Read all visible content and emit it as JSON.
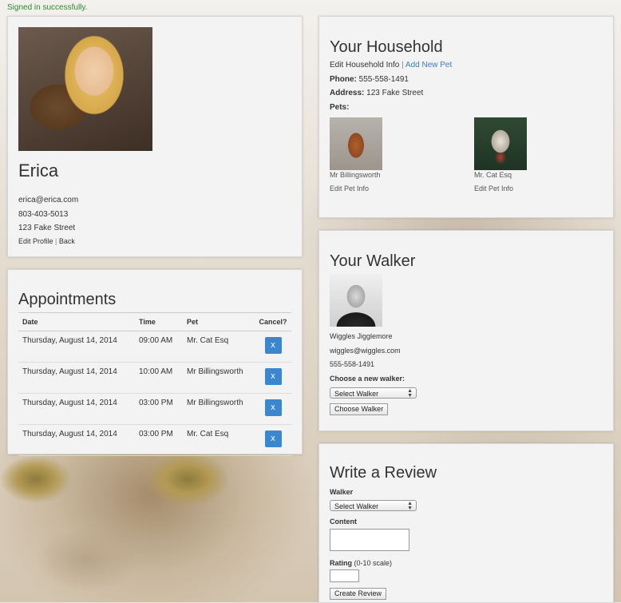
{
  "flash": "Signed in successfully.",
  "profile": {
    "name": "Erica",
    "email": "erica@erica.com",
    "phone": "803-403-5013",
    "address": "123 Fake Street",
    "edit_link": "Edit Profile",
    "separator": "|",
    "back_link": "Back"
  },
  "appointments": {
    "title": "Appointments",
    "headers": [
      "Date",
      "Time",
      "Pet",
      "Cancel?"
    ],
    "rows": [
      {
        "date": "Thursday, August 14, 2014",
        "time": "09:00 AM",
        "pet": "Mr. Cat Esq",
        "cancel": "x"
      },
      {
        "date": "Thursday, August 14, 2014",
        "time": "10:00 AM",
        "pet": "Mr Billingsworth",
        "cancel": "x"
      },
      {
        "date": "Thursday, August 14, 2014",
        "time": "03:00 PM",
        "pet": "Mr Billingsworth",
        "cancel": "x"
      },
      {
        "date": "Thursday, August 14, 2014",
        "time": "03:00 PM",
        "pet": "Mr. Cat Esq",
        "cancel": "x"
      }
    ]
  },
  "household": {
    "title": "Your Household",
    "edit_link": "Edit Household Info",
    "separator": "|",
    "add_pet_link": "Add New Pet",
    "phone_label": "Phone:",
    "phone": "555-558-1491",
    "address_label": "Address:",
    "address": "123 Fake Street",
    "pets_label": "Pets:",
    "pets": [
      {
        "name": "Mr Billingsworth",
        "edit": "Edit Pet Info"
      },
      {
        "name": "Mr. Cat Esq",
        "edit": "Edit Pet Info"
      }
    ]
  },
  "walker": {
    "title": "Your Walker",
    "name": "Wiggles Jigglemore",
    "email": "wiggles@wiggles.com",
    "phone": "555-558-1491",
    "choose_label": "Choose a new walker:",
    "select_value": "Select Walker",
    "button": "Choose Walker"
  },
  "review": {
    "title": "Write a Review",
    "walker_label": "Walker",
    "walker_select": "Select Walker",
    "content_label": "Content",
    "rating_label": "Rating",
    "rating_hint": "(0-10 scale)",
    "button": "Create Review"
  }
}
